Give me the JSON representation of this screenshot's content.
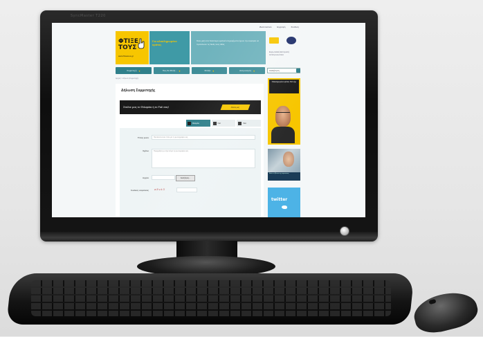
{
  "monitor": {
    "brand": "SyncMaster T220"
  },
  "site": {
    "topbar": [
      "Ιδεοπλαστικό",
      "Εγγραφή",
      "Σύνδεση"
    ],
    "logo_text": "ΦΤΙΞΕ ΤΟΥΣ",
    "logo_subtext": "www.ftixetous.gr",
    "tagline": "Για ολοκληρωμένο κράτος",
    "hero_text": "Όλοι μαζί στα Καλύτερα κρατικά επιχειρήματα έχουν την ευκαιρία να προτείνουν τις δικές τους ιδέες",
    "sponsor_text": "Ευρωπαϊκή Επιτροπή Αντιπροσωπεία",
    "nav": [
      {
        "label": "Συμμετοχή",
        "active": true
      },
      {
        "label": "Πώς θα Φτιάξ...",
        "active": false
      },
      {
        "label": "Φτιάξε",
        "active": false
      },
      {
        "label": "Διαγωνισμός",
        "active": false
      }
    ],
    "search": {
      "value": "Αναζήτηση"
    },
    "breadcrumb": "Αρχική > Δήλωση Συμμετοχής",
    "page_title": "Δήλωση Συμμετοχής",
    "promo": {
      "text": "Στείλτε μας το Φιλαράκι ή το Fail σας!",
      "badge": "Στείλτε μας"
    },
    "tabs": [
      {
        "label": "Φιλαράκι",
        "active": true
      },
      {
        "label": "Fail",
        "active": false
      },
      {
        "label": "Ιδέα",
        "active": false
      }
    ],
    "form": {
      "field1_label": "Τίτλος φωτο",
      "field1_placeholder": "Προτείνετε έναν τίτλο για τη φωτογραφία σας",
      "field2_label": "Σχόλιο",
      "field2_placeholder": "Περιγράψτε με λίγα λόγια τη φωτογραφία σας",
      "upload_label": "Αρχείο",
      "upload_button": "Αναζήτηση...",
      "captcha_label": "Κωδικός ασφαλείας",
      "captcha_text": "a8vk3"
    },
    "ads": {
      "ad1_text": "Ολοκληρωμένο κράτος Γιατί όχι;",
      "ad2_caption": "Δείτε το βίντεο της καμπάνιας",
      "twitter": "twitter"
    }
  }
}
